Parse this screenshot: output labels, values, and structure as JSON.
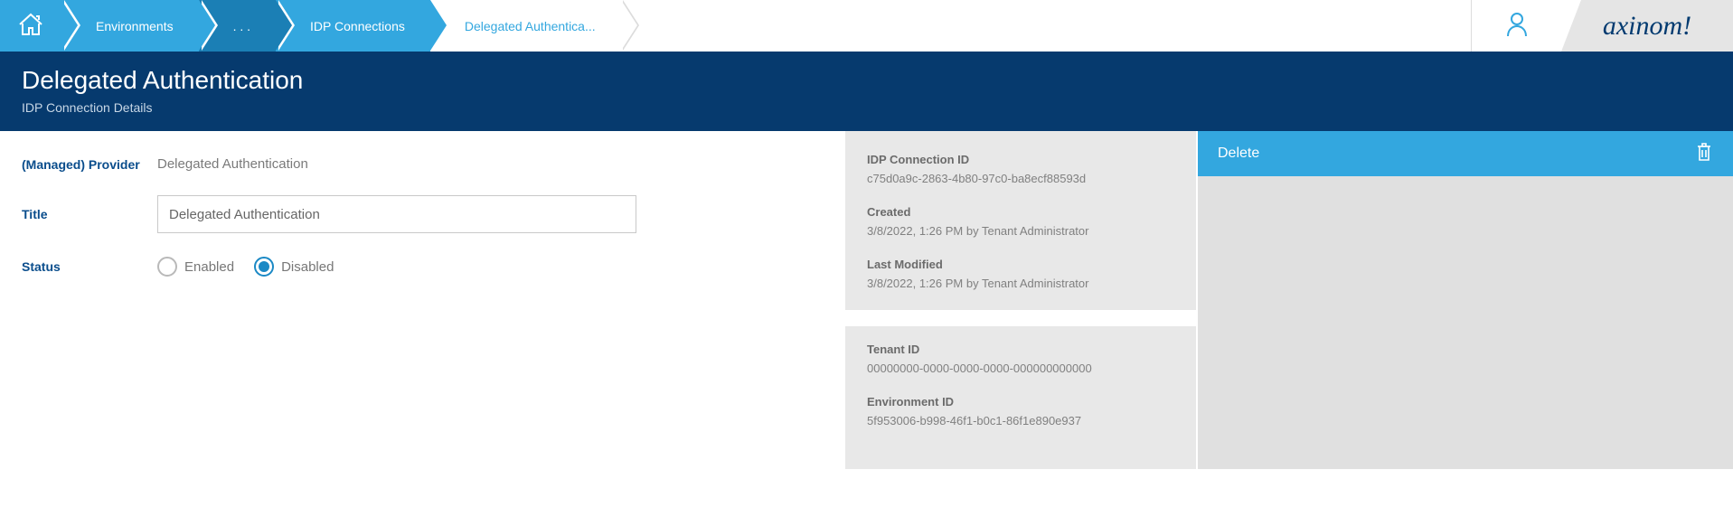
{
  "breadcrumb": {
    "environments": "Environments",
    "ellipsis": ". . .",
    "idp_connections": "IDP Connections",
    "current": "Delegated Authentica..."
  },
  "brand": "axinom!",
  "header": {
    "title": "Delegated Authentication",
    "subtitle": "IDP Connection Details"
  },
  "form": {
    "provider_label": "(Managed) Provider",
    "provider_value": "Delegated Authentication",
    "title_label": "Title",
    "title_value": "Delegated Authentication",
    "status_label": "Status",
    "status_enabled": "Enabled",
    "status_disabled": "Disabled",
    "status_selected": "disabled"
  },
  "meta": {
    "idp_id_label": "IDP Connection ID",
    "idp_id_value": "c75d0a9c-2863-4b80-97c0-ba8ecf88593d",
    "created_label": "Created",
    "created_value": "3/8/2022, 1:26 PM by Tenant Administrator",
    "modified_label": "Last Modified",
    "modified_value": "3/8/2022, 1:26 PM by Tenant Administrator",
    "tenant_id_label": "Tenant ID",
    "tenant_id_value": "00000000-0000-0000-0000-000000000000",
    "env_id_label": "Environment ID",
    "env_id_value": "5f953006-b998-46f1-b0c1-86f1e890e937"
  },
  "actions": {
    "delete": "Delete"
  }
}
